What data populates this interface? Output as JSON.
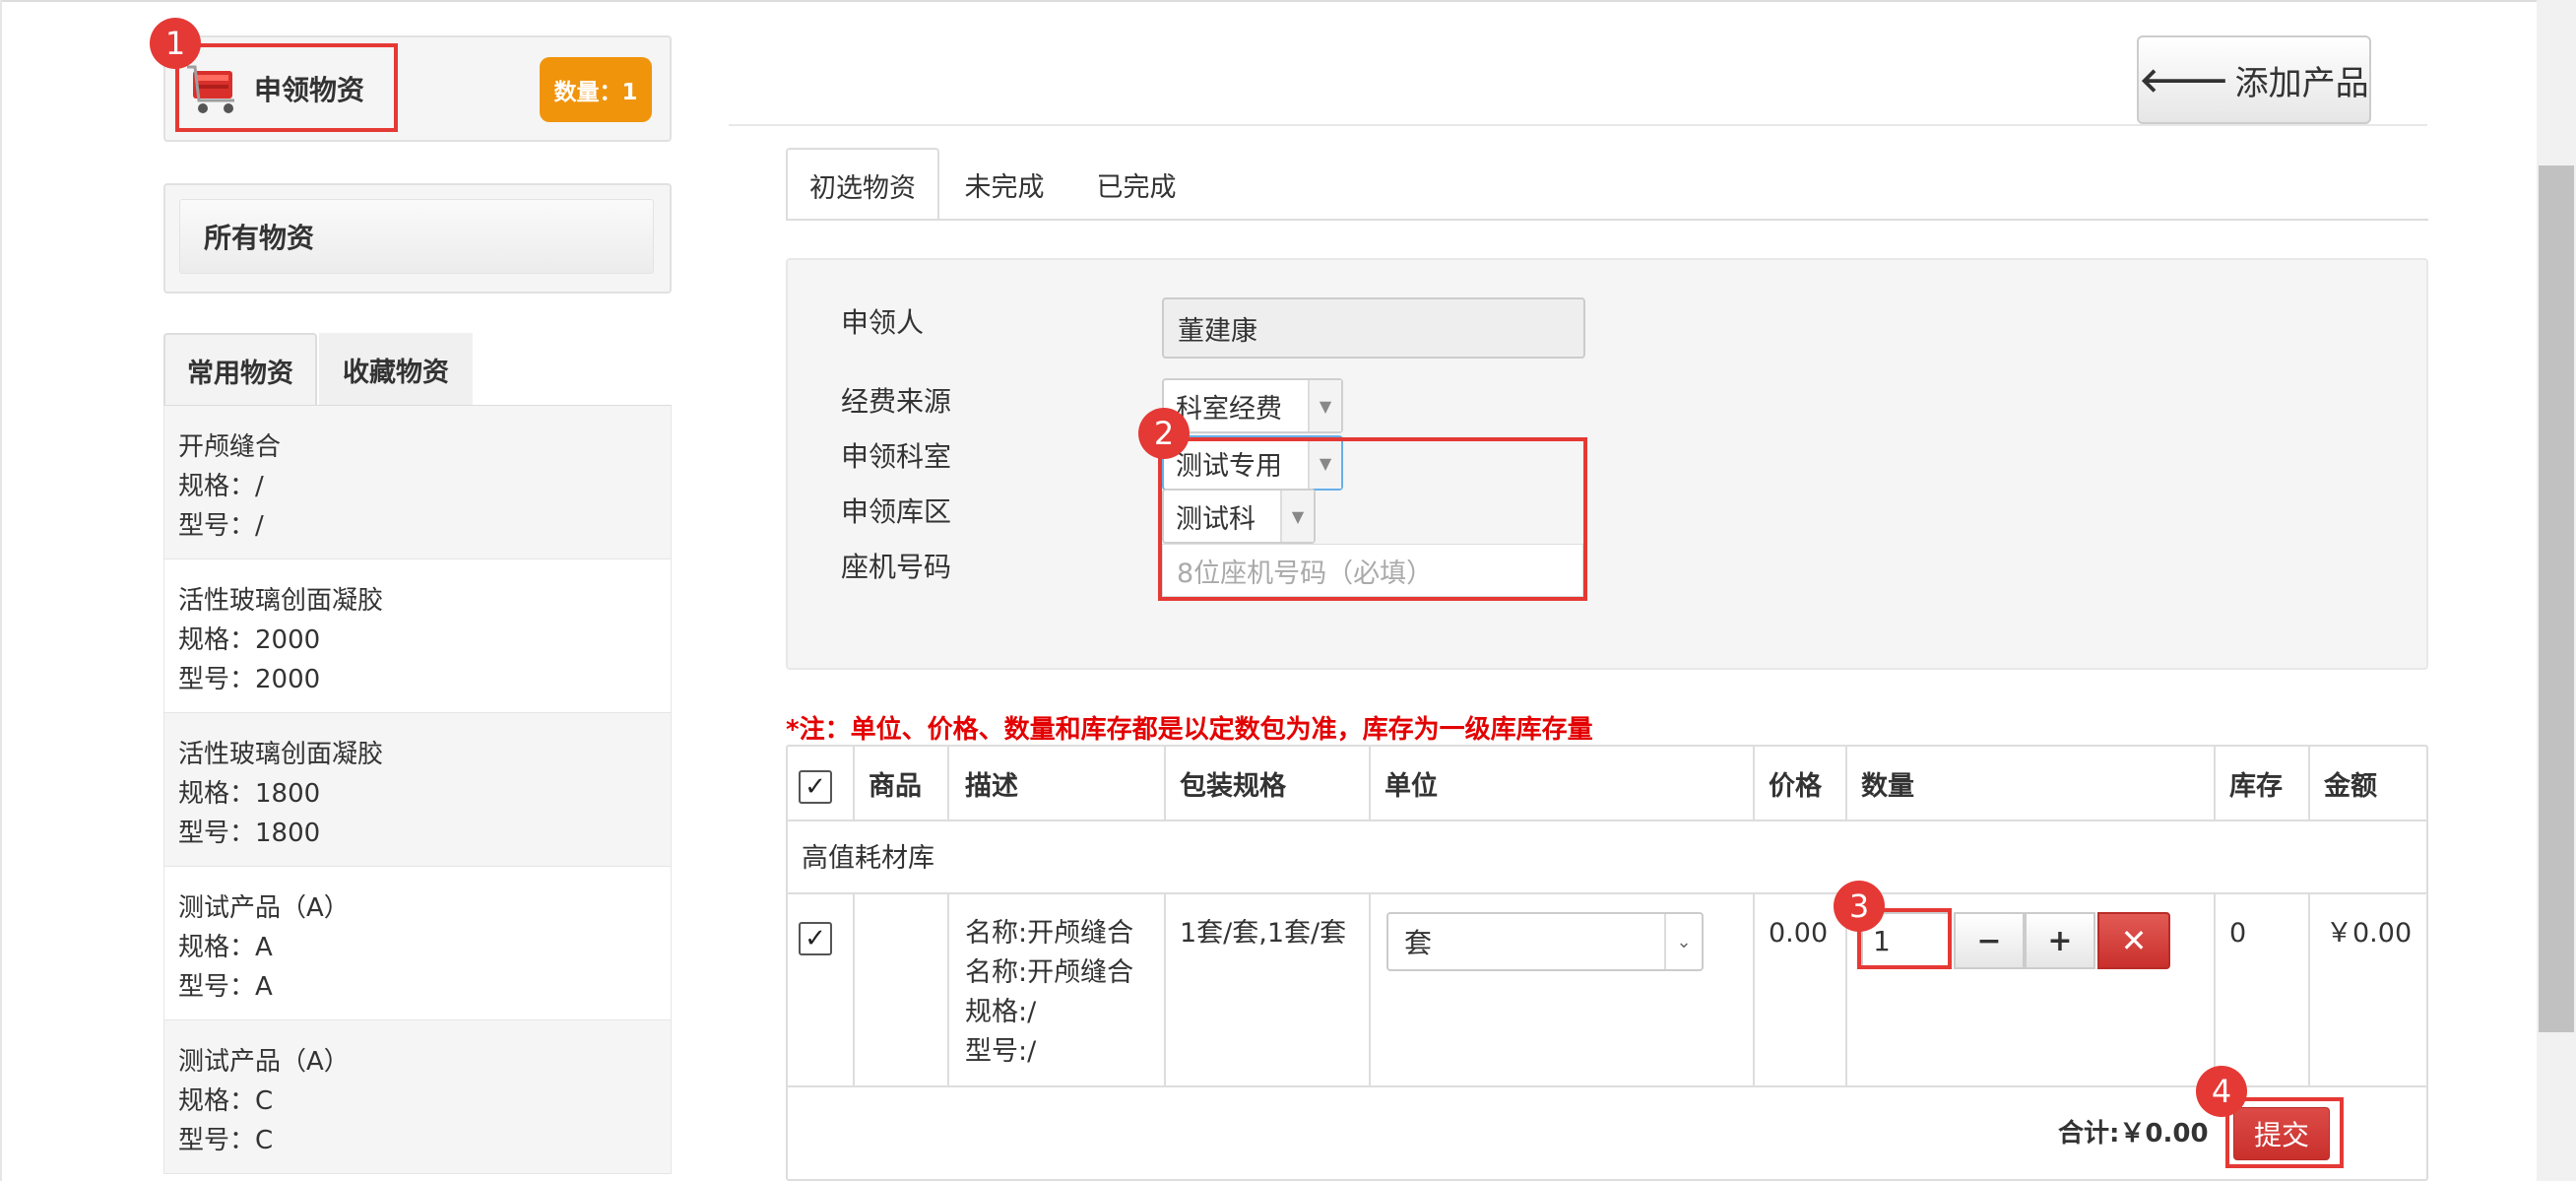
{
  "cart": {
    "title": "申领物资",
    "count_label": "数量：1"
  },
  "steps": [
    "1",
    "2",
    "3",
    "4"
  ],
  "all_items_label": "所有物资",
  "left_tabs": [
    "常用物资",
    "收藏物资"
  ],
  "products": [
    {
      "name": "开颅缝合",
      "spec": "规格：/",
      "model": "型号：/"
    },
    {
      "name": "活性玻璃创面凝胶",
      "spec": "规格：2000",
      "model": "型号：2000"
    },
    {
      "name": "活性玻璃创面凝胶",
      "spec": "规格：1800",
      "model": "型号：1800"
    },
    {
      "name": "测试产品（A）",
      "spec": "规格：A",
      "model": "型号：A"
    },
    {
      "name": "测试产品（A）",
      "spec": "规格：C",
      "model": "型号：C"
    }
  ],
  "add_product_label": "添加产品",
  "right_tabs": [
    "初选物资",
    "未完成",
    "已完成"
  ],
  "form": {
    "applicant_label": "申领人",
    "applicant_value": "董建康",
    "fund_label": "经费来源",
    "fund_value": "科室经费",
    "dept_label": "申领科室",
    "dept_value": "测试专用",
    "warehouse_label": "申领库区",
    "warehouse_value": "测试科",
    "phone_label": "座机号码",
    "phone_placeholder": "8位座机号码（必填）"
  },
  "note": "*注：单位、价格、数量和库存都是以定数包为准，库存为一级库库存量",
  "table": {
    "headers": [
      "商品",
      "描述",
      "包装规格",
      "单位",
      "价格",
      "数量",
      "库存",
      "金额"
    ],
    "group": "高值耗材库",
    "row": {
      "desc": [
        "名称:开颅缝合",
        "名称:开颅缝合",
        "规格:/",
        "型号:/"
      ],
      "package": "1套/套,1套/套",
      "unit": "套",
      "price": "0.00",
      "qty": "1",
      "stock": "0",
      "amount": "￥0.00"
    },
    "total": "合计:￥0.00",
    "submit": "提交"
  },
  "colors": {
    "accent_red": "#e53935",
    "badge_orange": "#f0940c",
    "note_red": "#e30000"
  }
}
